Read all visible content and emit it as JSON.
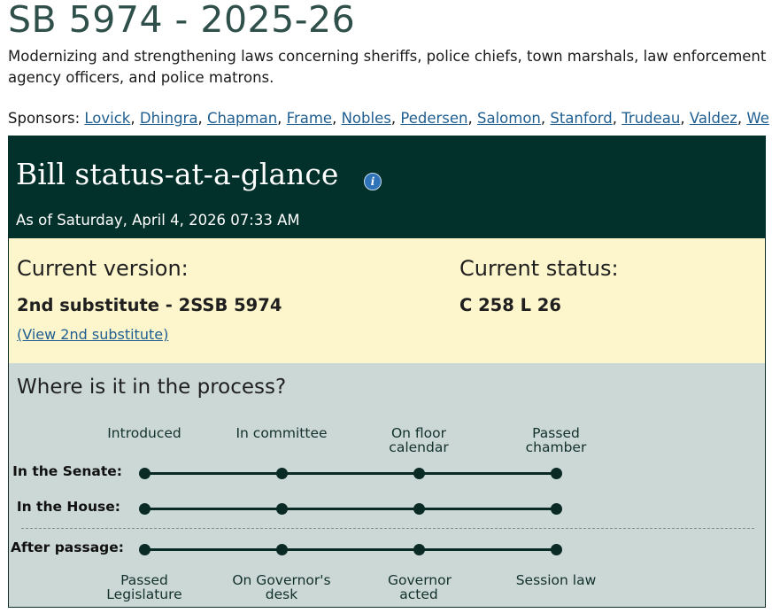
{
  "bill": {
    "title": "SB 5974 - 2025-26",
    "description": "Modernizing and strengthening laws concerning sheriffs, police chiefs, town marshals, law enforcement agency officers, and police matrons.",
    "sponsors_label": "Sponsors:",
    "sponsors": [
      "Lovick",
      "Dhingra",
      "Chapman",
      "Frame",
      "Nobles",
      "Pedersen",
      "Salomon",
      "Stanford",
      "Trudeau",
      "Valdez",
      "Wellman"
    ]
  },
  "status_panel": {
    "heading": "Bill status-at-a-glance",
    "info_icon": "info-icon",
    "as_of": "As of Saturday, April 4, 2026 07:33 AM",
    "current_version_label": "Current version:",
    "current_version_value": "2nd substitute - 2SSB 5974",
    "current_version_link": "(View 2nd substitute)",
    "current_status_label": "Current status:",
    "current_status_value": "C 258 L 26"
  },
  "process": {
    "heading": "Where is it in the process?",
    "legislative_stages": [
      "Introduced",
      "In committee",
      "On floor calendar",
      "Passed chamber"
    ],
    "rows": [
      {
        "label": "In the Senate:"
      },
      {
        "label": "In the House:"
      },
      {
        "label": "After passage:"
      }
    ],
    "after_passage_stages": [
      "Passed Legislature",
      "On Governor's desk",
      "Governor acted",
      "Session law"
    ]
  },
  "colors": {
    "title": "#2f4f4a",
    "header_bg": "#02302a",
    "version_bg": "#fdf5cc",
    "process_bg": "#ccd8d6",
    "link": "#1f5e91",
    "info_icon": "#2e72b8"
  }
}
